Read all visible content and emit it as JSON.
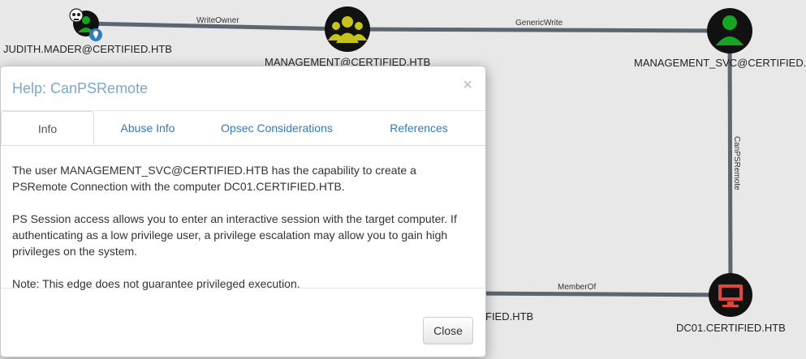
{
  "graph": {
    "nodes": {
      "judith": {
        "label": "JUDITH.MADER@CERTIFIED.HTB"
      },
      "management": {
        "label": "MANAGEMENT@CERTIFIED.HTB"
      },
      "management_svc": {
        "label": "MANAGEMENT_SVC@CERTIFIED.H"
      },
      "dc01": {
        "label": "DC01.CERTIFIED.HTB"
      },
      "partial": {
        "label": "FIED.HTB"
      }
    },
    "edges": {
      "write_owner": "WriteOwner",
      "generic_write": "GenericWrite",
      "can_ps_remote": "CanPSRemote",
      "member_of": "MemberOf"
    },
    "colors": {
      "user_node": "#17a324",
      "group_node": "#c6c31a",
      "computer_node": "#e0483f",
      "node_ring": "#111111",
      "edge": "#5c6670"
    }
  },
  "modal": {
    "title": "Help: CanPSRemote",
    "close_x": "×",
    "tabs": [
      {
        "label": "Info"
      },
      {
        "label": "Abuse Info"
      },
      {
        "label": "Opsec Considerations"
      },
      {
        "label": "References"
      }
    ],
    "active_tab": "Info",
    "paragraphs": [
      "The user MANAGEMENT_SVC@CERTIFIED.HTB has the capability to create a PSRemote Connection with the computer DC01.CERTIFIED.HTB.",
      "PS Session access allows you to enter an interactive session with the target computer. If authenticating as a low privilege user, a privilege escalation may allow you to gain high privileges on the system.",
      "Note: This edge does not guarantee privileged execution."
    ],
    "close_button": "Close"
  }
}
